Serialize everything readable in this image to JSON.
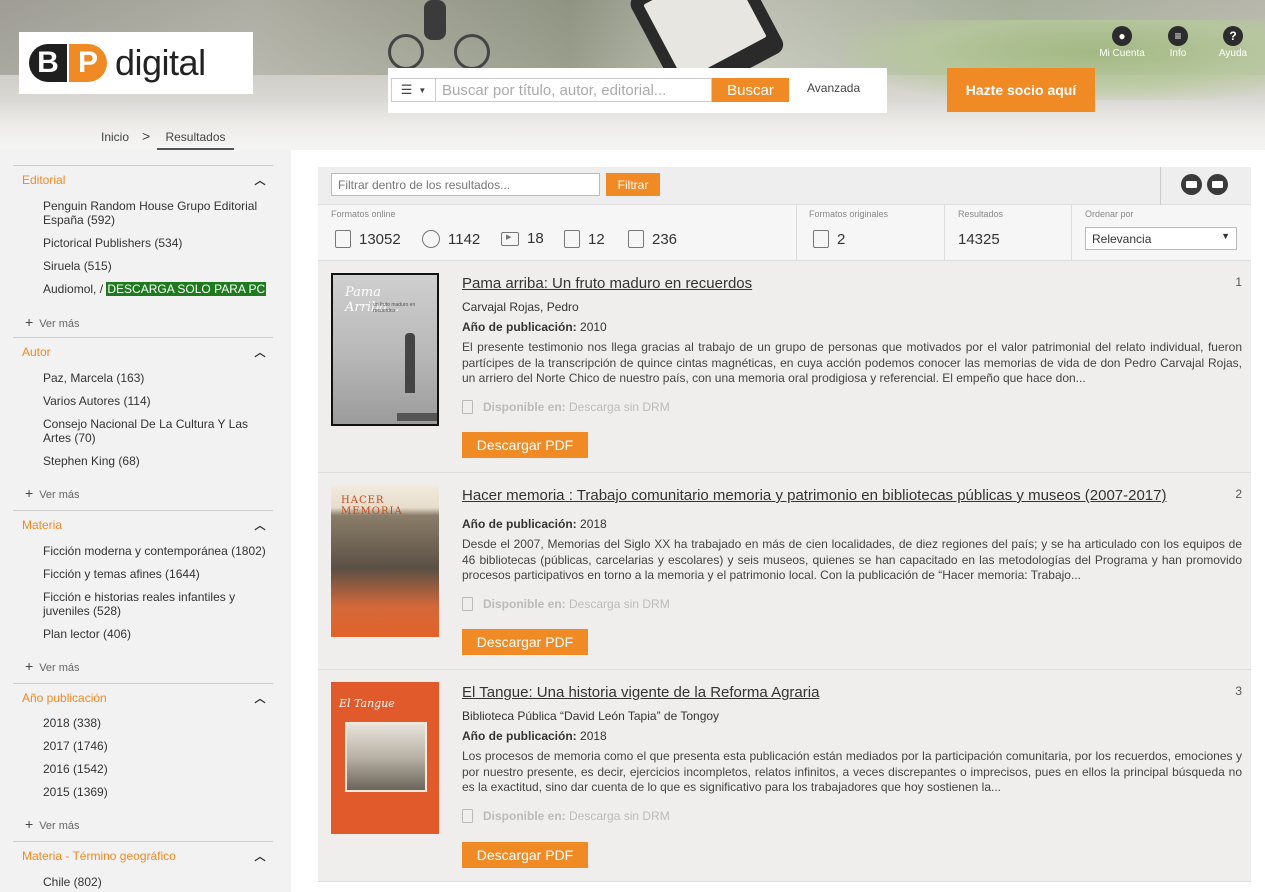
{
  "header": {
    "logo_b": "B",
    "logo_p": "P",
    "logo_word": "digital",
    "search_placeholder": "Buscar por título, autor, editorial...",
    "search_button": "Buscar",
    "advanced_link": "Avanzada",
    "join_button": "Hazte socio aquí",
    "icons": [
      {
        "label": "Mi Cuenta",
        "icon": "user-icon"
      },
      {
        "label": "Info",
        "icon": "menu-icon"
      },
      {
        "label": "Ayuda",
        "icon": "help-icon"
      }
    ]
  },
  "breadcrumb": {
    "home": "Inicio",
    "separator": ">",
    "current": "Resultados"
  },
  "facets": {
    "editorial": {
      "title": "Editorial",
      "items": [
        "Penguin Random House Grupo Editorial España (592)",
        "Pictorical Publishers (534)",
        "Siruela (515)"
      ],
      "item4_prefix": "Audiomol, /",
      "item4_highlight": "DESCARGA SOLO PARA PC",
      "more": "Ver más"
    },
    "autor": {
      "title": "Autor",
      "items": [
        "Paz, Marcela (163)",
        "Varios Autores (114)",
        "Consejo Nacional De La Cultura Y Las Artes (70)",
        "Stephen King (68)"
      ],
      "more": "Ver más"
    },
    "materia": {
      "title": "Materia",
      "items": [
        "Ficción moderna y contemporánea (1802)",
        "Ficción y temas afines (1644)",
        "Ficción e historias reales infantiles y juveniles (528)",
        "Plan lector (406)"
      ],
      "more": "Ver más"
    },
    "anio": {
      "title": "Año publicación",
      "items": [
        "2018 (338)",
        "2017 (1746)",
        "2016 (1542)",
        "2015 (1369)"
      ],
      "more": "Ver más"
    },
    "geo": {
      "title": "Materia - Término geográfico",
      "items": [
        "Chile (802)"
      ]
    }
  },
  "toolbar": {
    "filter_placeholder": "Filtrar dentro de los resultados...",
    "filter_button": "Filtrar"
  },
  "stats": {
    "online_label": "Formatos online",
    "online_counts": {
      "ebook": "13052",
      "audio": "1142",
      "video": "18",
      "image": "12",
      "document": "236"
    },
    "original_label": "Formatos originales",
    "original_count": "2",
    "results_label": "Resultados",
    "results_count": "14325",
    "sort_label": "Ordenar por",
    "sort_value": "Relevancia"
  },
  "results": [
    {
      "num": "1",
      "title": "Pama arriba: Un fruto maduro en recuerdos",
      "author": "Carvajal Rojas, Pedro",
      "year_label": "Año de publicación:",
      "year": "2010",
      "description": "El presente testimonio nos llega gracias al trabajo de un grupo de personas que motivados por el valor patrimonial del relato individual, fueron partícipes de la transcripción de quince cintas magnéticas, en cuya acción podemos conocer las memorias de vida de don Pedro Carvajal Rojas, un arriero del Norte Chico de nuestro país, con una memoria oral prodigiosa y referencial. El empeño que hace don...",
      "avail_label": "Disponible en:",
      "avail_value": "Descarga sin DRM",
      "download": "Descargar PDF",
      "cover_title": "Pama Arriba...",
      "cover_subtitle": "un fruto maduro en recuerdos"
    },
    {
      "num": "2",
      "title": "Hacer memoria : Trabajo comunitario memoria y patrimonio en bibliotecas públicas y museos (2007-2017)",
      "year_label": "Año de publicación:",
      "year": "2018",
      "description": "Desde el 2007, Memorias del Siglo XX ha trabajado en más de cien localidades, de diez regiones del país; y se ha articulado con los equipos de 46 bibliotecas (públicas, carcelarias y escolares) y seis museos, quienes se han capacitado en las metodologías del Programa y han promovido procesos participativos en torno a la memoria y el patrimonio local. Con la publicación de “Hacer memoria: Trabajo...",
      "avail_label": "Disponible en:",
      "avail_value": "Descarga sin DRM",
      "download": "Descargar PDF",
      "cover_title": "HACER MEMORIA"
    },
    {
      "num": "3",
      "title": "El Tangue: Una historia vigente de la Reforma Agraria",
      "author": "Biblioteca Pública “David León Tapia” de Tongoy",
      "year_label": "Año de publicación:",
      "year": "2018",
      "description": "Los procesos de memoria como el que presenta esta publicación están mediados por la participación comunitaria, por los recuerdos, emociones y por nuestro presente, es decir, ejercicios incompletos, relatos infinitos, a veces discrepantes o imprecisos, pues en ellos la principal búsqueda no es la exactitud, sino dar cuenta de lo que es significativo para los trabajadores que hoy sostienen la...",
      "avail_label": "Disponible en:",
      "avail_value": "Descarga sin DRM",
      "download": "Descargar PDF",
      "cover_title": "El Tangue"
    }
  ]
}
